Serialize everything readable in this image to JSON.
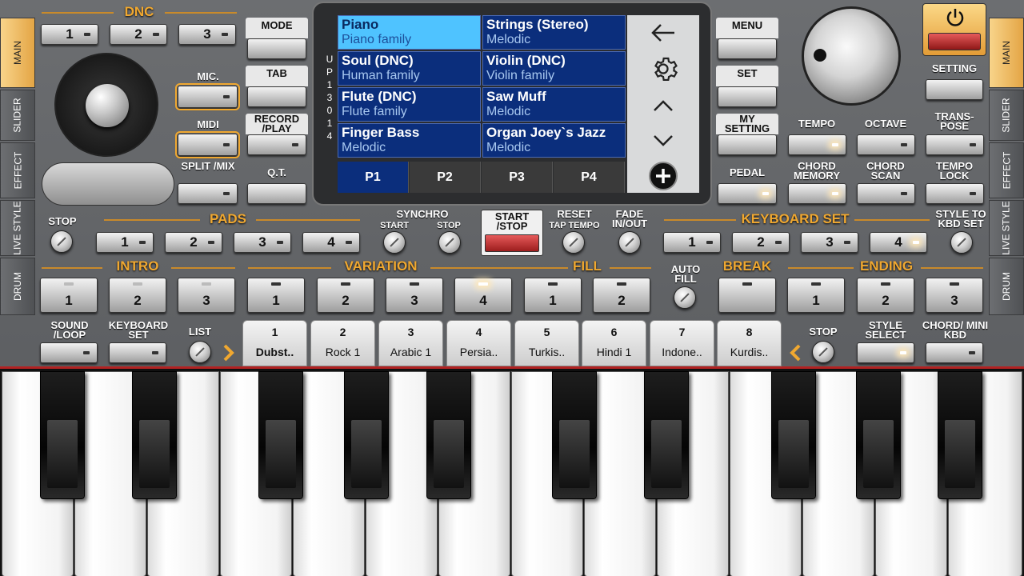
{
  "side_tabs_left": [
    "MAIN",
    "SLIDER",
    "EFFECT",
    "LIVE STYLE",
    "DRUM"
  ],
  "side_tabs_right": [
    "MAIN",
    "SLIDER",
    "EFFECT",
    "LIVE STYLE",
    "DRUM"
  ],
  "dnc": {
    "title": "DNC",
    "buttons": [
      "1",
      "2",
      "3"
    ]
  },
  "left_controls": {
    "mic": "MIC.",
    "midi": "MIDI",
    "split_mix": "SPLIT /MIX",
    "mode": "MODE",
    "tab": "TAB",
    "record_play": "RECORD /PLAY",
    "qt": "Q.T."
  },
  "screen": {
    "side_label": "UP 1 30 1 4",
    "voices": [
      {
        "name": "Piano",
        "family": "Piano family",
        "selected": true
      },
      {
        "name": "Strings (Stereo)",
        "family": "Melodic"
      },
      {
        "name": "Soul (DNC)",
        "family": "Human family"
      },
      {
        "name": "Violin (DNC)",
        "family": "Violin family"
      },
      {
        "name": "Flute (DNC)",
        "family": "Flute family"
      },
      {
        "name": "Saw Muff",
        "family": "Melodic"
      },
      {
        "name": "Finger Bass",
        "family": "Melodic"
      },
      {
        "name": "Organ Joey`s Jazz",
        "family": "Melodic"
      }
    ],
    "pages": [
      "P1",
      "P2",
      "P3",
      "P4"
    ],
    "active_page": "P1"
  },
  "right_controls": {
    "menu": "MENU",
    "set": "SET",
    "my_setting": "MY SETTING",
    "pedal": "PEDAL",
    "setting": "SETTING",
    "tempo": "TEMPO",
    "octave": "OCTAVE",
    "transpose": "TRANS- POSE",
    "chord_memory": "CHORD MEMORY",
    "chord_scan": "CHORD SCAN",
    "tempo_lock": "TEMPO LOCK"
  },
  "row_pads": {
    "stop": "STOP",
    "pads": "PADS",
    "pad_buttons": [
      "1",
      "2",
      "3",
      "4"
    ],
    "synchro": "SYNCHRO",
    "synchro_start": "START",
    "synchro_stop": "STOP",
    "start_stop": "START /STOP",
    "reset": "RESET",
    "tap_tempo": "TAP TEMPO",
    "fade": "FADE IN/OUT",
    "keyboard_set": "KEYBOARD SET",
    "kbd_buttons": [
      "1",
      "2",
      "3",
      "4"
    ],
    "style_to_kbd": "STYLE TO KBD SET"
  },
  "row_sections": {
    "intro": "INTRO",
    "intro_buttons": [
      "1",
      "2",
      "3"
    ],
    "variation": "VARIATION",
    "variation_buttons": [
      "1",
      "2",
      "3",
      "4"
    ],
    "fill": "FILL",
    "fill_buttons": [
      "1",
      "2"
    ],
    "auto_fill": "AUTO FILL",
    "break": "BREAK",
    "ending": "ENDING",
    "ending_buttons": [
      "1",
      "2",
      "3"
    ]
  },
  "row_styles": {
    "sound_loop": "SOUND /LOOP",
    "keyboard_set": "KEYBOARD SET",
    "list": "LIST",
    "stop": "STOP",
    "style_select": "STYLE SELECT",
    "chord_mini_kbd": "CHORD/ MINI KBD",
    "styles": [
      {
        "num": "1",
        "name": "Dubst.."
      },
      {
        "num": "2",
        "name": "Rock 1"
      },
      {
        "num": "3",
        "name": "Arabic 1"
      },
      {
        "num": "4",
        "name": "Persia.."
      },
      {
        "num": "5",
        "name": "Turkis.."
      },
      {
        "num": "6",
        "name": "Hindi 1"
      },
      {
        "num": "7",
        "name": "Indone.."
      },
      {
        "num": "8",
        "name": "Kurdis.."
      }
    ]
  },
  "colors": {
    "accent": "#f0a830",
    "screen_blue": "#0b2e7c",
    "selected_voice": "#4fc3ff",
    "record_red": "#c0282d"
  }
}
